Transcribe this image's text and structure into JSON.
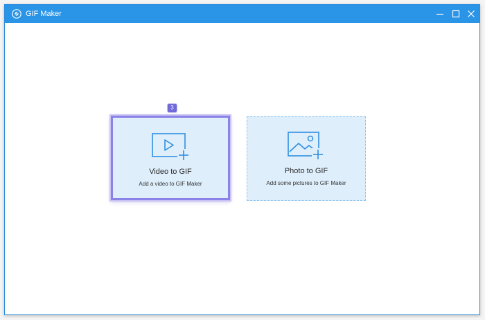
{
  "window": {
    "title": "GIF Maker",
    "controls": {
      "minimize": "minimize-icon",
      "maximize": "maximize-icon",
      "close": "close-icon"
    }
  },
  "step_badge": "3",
  "options": [
    {
      "title": "Video to GIF",
      "description": "Add a video to GIF Maker",
      "icon": "video-add-icon"
    },
    {
      "title": "Photo to GIF",
      "description": "Add some pictures to GIF Maker",
      "icon": "photo-add-icon"
    }
  ],
  "colors": {
    "titlebar": "#2a94e6",
    "card_background": "#deeefb",
    "icon_stroke": "#2f8fe0",
    "highlight": "#8a82e6",
    "badge": "#6f69d9"
  }
}
